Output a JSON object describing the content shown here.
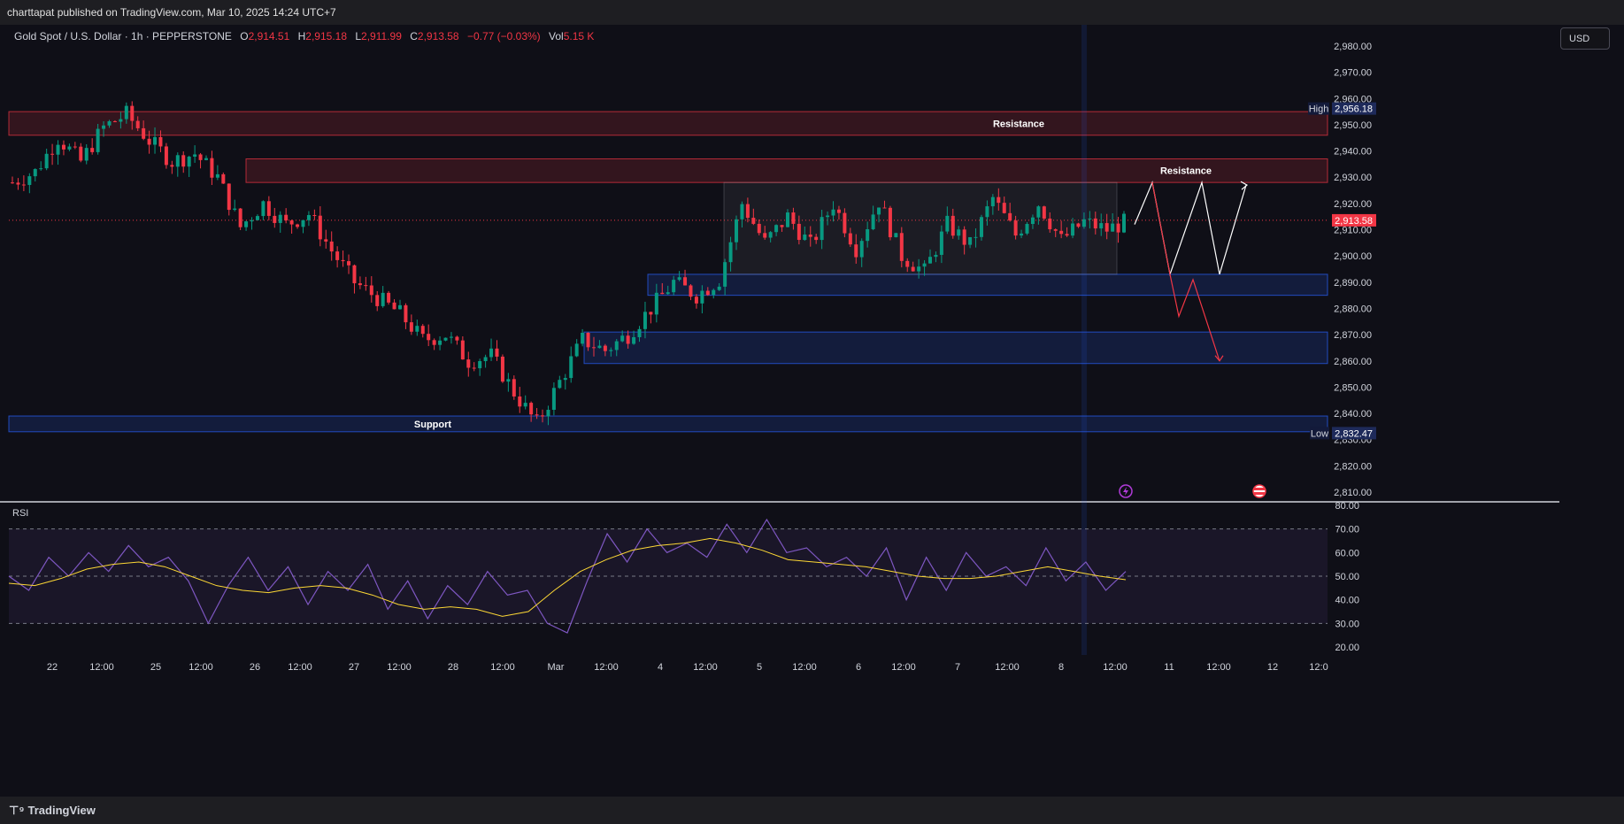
{
  "header": {
    "published": "charttapat published on TradingView.com, Mar 10, 2025 14:24 UTC+7"
  },
  "legend": {
    "symbol": "Gold Spot / U.S. Dollar · 1h · PEPPERSTONE",
    "open_label": "O",
    "open": "2,914.51",
    "high_label": "H",
    "high": "2,915.18",
    "low_label": "L",
    "low": "2,911.99",
    "close_label": "C",
    "close": "2,913.58",
    "change": "−0.77 (−0.03%)",
    "vol_label": "Vol",
    "vol": "5.15 K"
  },
  "currency_button": "USD",
  "footer": {
    "brand": "TradingView",
    "logo": "tradingview-logo-icon"
  },
  "colors": {
    "up": "#089981",
    "down": "#f23645",
    "rsi": "#7e57c2",
    "rsi_ma": "#fdd835",
    "zone_red": "#f23645",
    "zone_blue": "#2962ff"
  },
  "chart_data": [
    {
      "type": "candlestick",
      "title": "Gold Spot / U.S. Dollar · 1h · PEPPERSTONE",
      "ylim": [
        2800,
        2985
      ],
      "y_ticks": [
        2810,
        2820,
        2830,
        2840,
        2850,
        2860,
        2870,
        2880,
        2890,
        2900,
        2910,
        2920,
        2930,
        2940,
        2950,
        2960,
        2970,
        2980
      ],
      "x_tick_labels": [
        "22",
        "12:00",
        "25",
        "12:00",
        "26",
        "12:00",
        "27",
        "12:00",
        "28",
        "12:00",
        "Mar",
        "12:00",
        "4",
        "12:00",
        "5",
        "12:00",
        "6",
        "12:00",
        "7",
        "12:00",
        "8",
        "12:00",
        "11",
        "12:00",
        "12",
        "12:0"
      ],
      "price_path": [
        [
          2928,
          2932
        ],
        [
          2932,
          2945
        ],
        [
          2945,
          2936
        ],
        [
          2936,
          2949
        ],
        [
          2949,
          2954
        ],
        [
          2954,
          2944
        ],
        [
          2944,
          2936
        ],
        [
          2936,
          2939
        ],
        [
          2939,
          2930
        ],
        [
          2930,
          2911
        ],
        [
          2911,
          2920
        ],
        [
          2920,
          2912
        ],
        [
          2912,
          2916
        ],
        [
          2916,
          2902
        ],
        [
          2902,
          2890
        ],
        [
          2890,
          2884
        ],
        [
          2884,
          2878
        ],
        [
          2878,
          2868
        ],
        [
          2868,
          2870
        ],
        [
          2870,
          2860
        ],
        [
          2860,
          2862
        ],
        [
          2862,
          2848
        ],
        [
          2848,
          2836
        ],
        [
          2836,
          2852
        ],
        [
          2852,
          2868
        ],
        [
          2868,
          2864
        ],
        [
          2864,
          2870
        ],
        [
          2870,
          2880
        ],
        [
          2880,
          2890
        ],
        [
          2890,
          2885
        ],
        [
          2885,
          2891
        ],
        [
          2891,
          2920
        ],
        [
          2920,
          2905
        ],
        [
          2905,
          2915
        ],
        [
          2915,
          2904
        ],
        [
          2904,
          2920
        ],
        [
          2920,
          2903
        ],
        [
          2903,
          2921
        ],
        [
          2921,
          2900
        ],
        [
          2900,
          2894
        ],
        [
          2894,
          2912
        ],
        [
          2912,
          2904
        ],
        [
          2904,
          2922
        ],
        [
          2922,
          2908
        ],
        [
          2908,
          2920
        ],
        [
          2920,
          2906
        ],
        [
          2906,
          2913
        ],
        [
          2913,
          2910
        ],
        [
          2910,
          2913.58
        ]
      ],
      "current_price": "2,913.58",
      "high": {
        "label": "High",
        "value": "2,956.18"
      },
      "low": {
        "label": "Low",
        "value": "2,832.47"
      },
      "zones": [
        {
          "kind": "resistance",
          "label": "Resistance",
          "from": 2946,
          "to": 2955
        },
        {
          "kind": "resistance",
          "label": "Resistance",
          "from": 2928,
          "to": 2937
        },
        {
          "kind": "support-range",
          "label": "",
          "from": 2885,
          "to": 2893
        },
        {
          "kind": "support-range",
          "label": "",
          "from": 2859,
          "to": 2871
        },
        {
          "kind": "support",
          "label": "Support",
          "from": 2833,
          "to": 2839
        }
      ],
      "range_box": {
        "from": 2893,
        "to": 2928
      },
      "projection_white": [
        2912,
        2928,
        2893,
        2928,
        2893,
        2927
      ],
      "projection_red": [
        2928,
        2893,
        2877,
        2891,
        2860
      ],
      "event_icons": [
        "lightning-event-icon",
        "us-flag-event-icon"
      ]
    },
    {
      "type": "line",
      "title": "RSI",
      "ylim": [
        15,
        82
      ],
      "y_ticks": [
        20,
        30,
        40,
        50,
        60,
        70,
        80
      ],
      "band": [
        30,
        70
      ],
      "midline": 50,
      "rsi_path": [
        50,
        44,
        58,
        50,
        60,
        52,
        63,
        54,
        58,
        48,
        30,
        46,
        58,
        44,
        54,
        38,
        52,
        44,
        55,
        36,
        48,
        32,
        46,
        38,
        52,
        42,
        44,
        30,
        26,
        48,
        68,
        56,
        70,
        60,
        64,
        58,
        72,
        60,
        74,
        60,
        62,
        54,
        58,
        50,
        62,
        40,
        58,
        44,
        60,
        50,
        54,
        46,
        62,
        48,
        56,
        44,
        52
      ],
      "rsi_ma_path": [
        47,
        46,
        49,
        53,
        55,
        56,
        54,
        50,
        46,
        44,
        43,
        45,
        46,
        45,
        42,
        38,
        36,
        37,
        36,
        33,
        35,
        44,
        52,
        57,
        61,
        63,
        64,
        66,
        64,
        61,
        57,
        56,
        55,
        54,
        52,
        50,
        49,
        49,
        50,
        52,
        54,
        52,
        50,
        48.5
      ]
    }
  ]
}
